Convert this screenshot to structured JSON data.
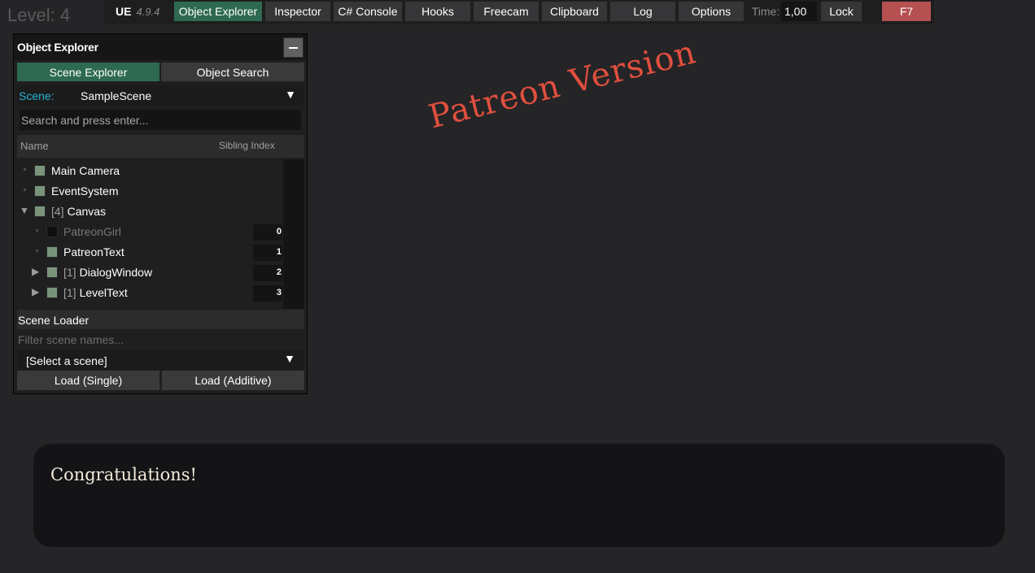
{
  "game": {
    "level_text": "Level: 4",
    "watermark": "Patreon Version",
    "dialog_text": "Congratulations!"
  },
  "navbar": {
    "title": "UE",
    "version": "4.9.4",
    "buttons": [
      {
        "label": "Object Explorer",
        "active": true
      },
      {
        "label": "Inspector"
      },
      {
        "label": "C# Console"
      },
      {
        "label": "Hooks"
      },
      {
        "label": "Freecam"
      },
      {
        "label": "Clipboard"
      },
      {
        "label": "Log"
      },
      {
        "label": "Options"
      }
    ],
    "time_label": "Time:",
    "time_value": "1,00",
    "lock_label": "Lock",
    "close_label": "F7"
  },
  "panel": {
    "title": "Object Explorer",
    "tabs": {
      "scene_explorer": "Scene Explorer",
      "object_search": "Object Search"
    },
    "scene_label": "Scene:",
    "scene_value": "SampleScene",
    "search_placeholder": "Search and press enter...",
    "columns": {
      "name": "Name",
      "sibling_index": "Sibling Index"
    },
    "tree": [
      {
        "label": "Main Camera",
        "count": "",
        "index": "",
        "enabled": true,
        "dim": false
      },
      {
        "label": "EventSystem",
        "count": "",
        "index": "",
        "enabled": true,
        "dim": false
      },
      {
        "label": "Canvas",
        "count": "[4]",
        "index": "",
        "enabled": true,
        "dim": false,
        "expanded": true
      },
      {
        "label": "PatreonGirl",
        "count": "",
        "index": "0",
        "enabled": false,
        "dim": true
      },
      {
        "label": "PatreonText",
        "count": "",
        "index": "1",
        "enabled": true,
        "dim": false
      },
      {
        "label": "DialogWindow",
        "count": "[1]",
        "index": "2",
        "enabled": true,
        "dim": false
      },
      {
        "label": "LevelText",
        "count": "[1]",
        "index": "3",
        "enabled": true,
        "dim": false
      }
    ],
    "scene_loader": {
      "title": "Scene Loader",
      "filter_placeholder": "Filter scene names...",
      "select_value": "[Select a scene]",
      "load_single": "Load (Single)",
      "load_additive": "Load (Additive)"
    }
  }
}
